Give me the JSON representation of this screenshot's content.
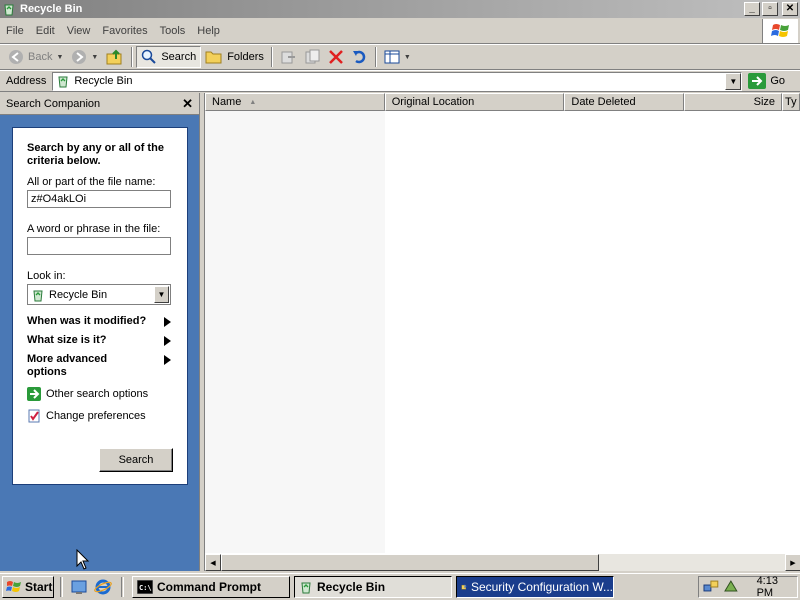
{
  "window": {
    "title": "Recycle Bin"
  },
  "window_buttons": [
    "_",
    "▫",
    "✕"
  ],
  "menu": [
    "File",
    "Edit",
    "View",
    "Favorites",
    "Tools",
    "Help"
  ],
  "menu_underline": [
    "F",
    "E",
    "V",
    "a",
    "T",
    "H"
  ],
  "toolbar": {
    "back": "Back",
    "search": "Search",
    "folders": "Folders"
  },
  "address": {
    "label": "Address",
    "value": "Recycle Bin",
    "go": "Go"
  },
  "search_companion": {
    "title": "Search Companion",
    "heading": "Search by any or all of the criteria below.",
    "filename_label": "All or part of the file name:",
    "filename_value": "z#O4akLOi",
    "phrase_label": "A word or phrase in the file:",
    "phrase_value": "",
    "lookin_label": "Look in:",
    "lookin_value": "Recycle Bin",
    "expanders": [
      "When was it modified?",
      "What size is it?",
      "More advanced options"
    ],
    "links": [
      "Other search options",
      "Change preferences"
    ],
    "search_button": "Search"
  },
  "file_list": {
    "columns": [
      "Name",
      "Original Location",
      "Date Deleted",
      "Size",
      "Ty"
    ]
  },
  "taskbar": {
    "start": "Start",
    "tasks": [
      "Command Prompt",
      "Recycle Bin",
      "Security Configuration W..."
    ],
    "clock": "4:13 PM"
  },
  "colors": {
    "pane_blue": "#4a78b5",
    "active_task": "#1a3d8c"
  }
}
